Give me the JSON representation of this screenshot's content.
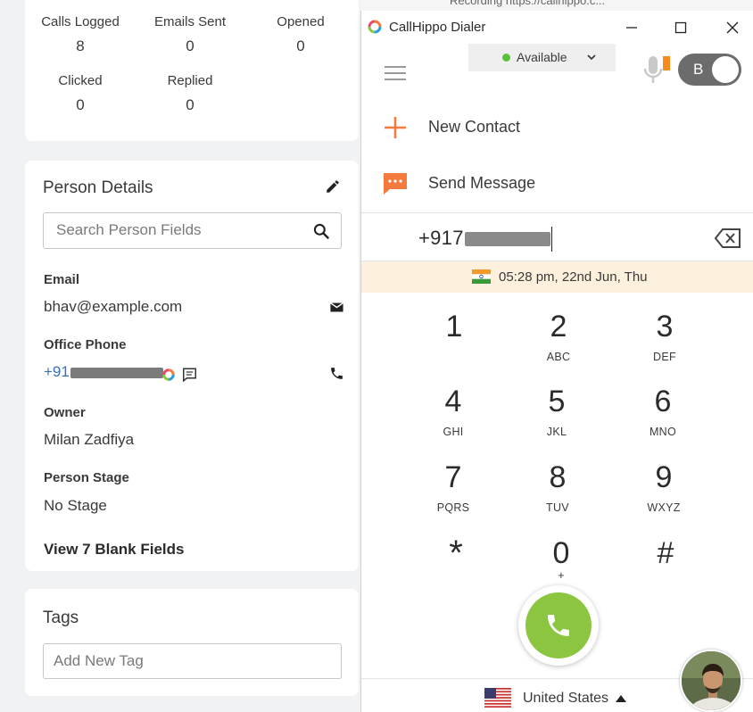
{
  "stats": [
    {
      "label": "Calls Logged",
      "value": "8"
    },
    {
      "label": "Emails Sent",
      "value": "0"
    },
    {
      "label": "Opened",
      "value": "0"
    },
    {
      "label": "Clicked",
      "value": "0"
    },
    {
      "label": "Replied",
      "value": "0"
    }
  ],
  "background_snippet": "Recording https://callhippo.c...",
  "person": {
    "title": "Person Details",
    "search_placeholder": "Search Person Fields",
    "email_label": "Email",
    "email_value": "bhav@example.com",
    "phone_label": "Office Phone",
    "phone_prefix": "+91",
    "owner_label": "Owner",
    "owner_value": "Milan Zadfiya",
    "stage_label": "Person Stage",
    "stage_value": "No Stage",
    "view_blank": "View 7 Blank Fields"
  },
  "tags": {
    "title": "Tags",
    "placeholder": "Add New Tag"
  },
  "dialer": {
    "window_title": "CallHippo Dialer",
    "status": "Available",
    "status_color": "#5cc13a",
    "user_initial": "B",
    "menu": [
      {
        "label": "New Contact",
        "icon": "plus-icon"
      },
      {
        "label": "Send Message",
        "icon": "message-icon"
      }
    ],
    "number_prefix": "+917",
    "datetime": "05:28 pm, 22nd Jun, Thu",
    "keys": [
      {
        "digit": "1",
        "letters": ""
      },
      {
        "digit": "2",
        "letters": "ABC"
      },
      {
        "digit": "3",
        "letters": "DEF"
      },
      {
        "digit": "4",
        "letters": "GHI"
      },
      {
        "digit": "5",
        "letters": "JKL"
      },
      {
        "digit": "6",
        "letters": "MNO"
      },
      {
        "digit": "7",
        "letters": "PQRS"
      },
      {
        "digit": "8",
        "letters": "TUV"
      },
      {
        "digit": "9",
        "letters": "WXYZ"
      },
      {
        "digit": "*",
        "letters": ""
      },
      {
        "digit": "0",
        "letters": "+"
      },
      {
        "digit": "#",
        "letters": ""
      }
    ],
    "country": "United States",
    "accent_color": "#f47b3e",
    "call_color": "#8cc540"
  }
}
